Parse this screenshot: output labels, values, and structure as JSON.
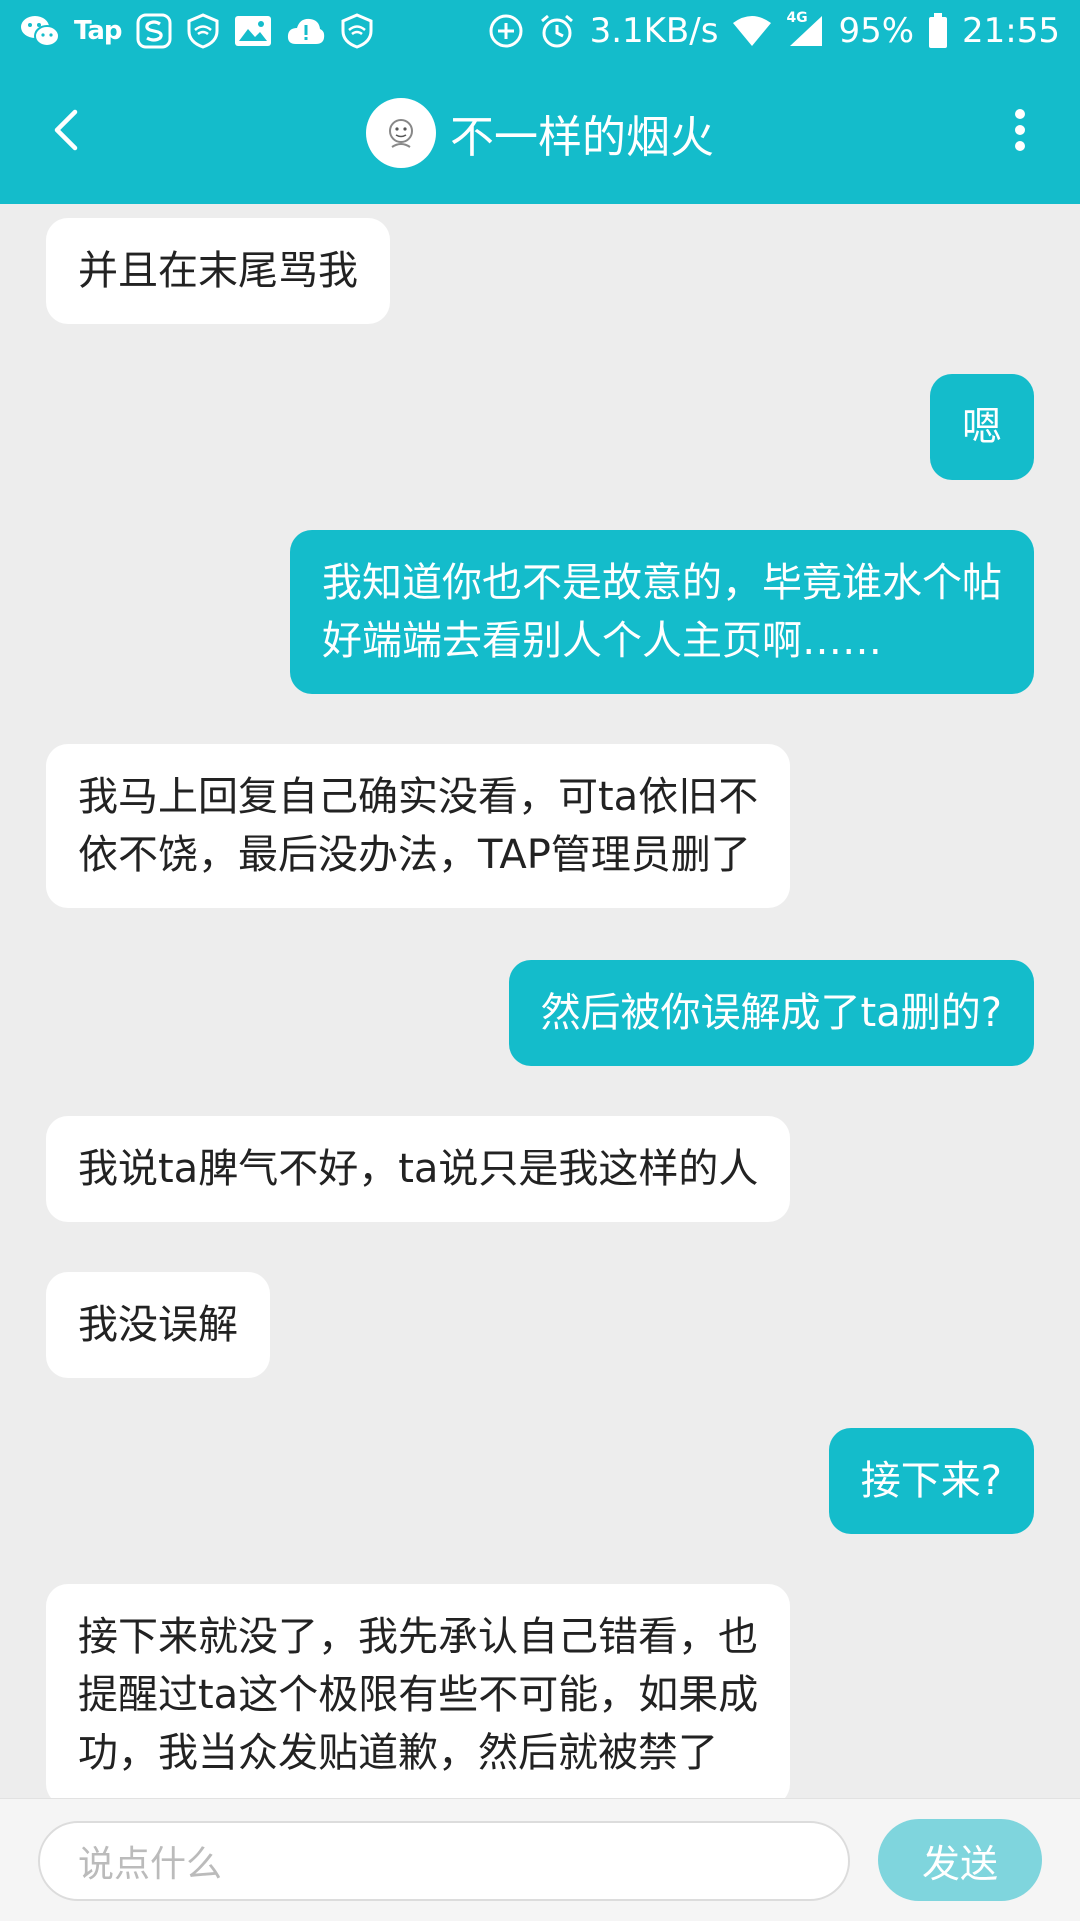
{
  "status_bar": {
    "left_icons": [
      "wechat-icon",
      "tap-icon",
      "s-app-icon",
      "shield-icon",
      "image-icon",
      "cloud-alert-icon",
      "shield-icon"
    ],
    "tap_label": "Tap",
    "network_speed": "3.1KB/s",
    "network_type": "4G",
    "battery": "95%",
    "time": "21:55"
  },
  "header": {
    "title": "不一样的烟火",
    "back_icon": "chevron-left-icon",
    "more_icon": "more-vertical-icon",
    "accent_color": "#14bccb"
  },
  "messages": [
    {
      "direction": "in",
      "text": "并且在末尾骂我"
    },
    {
      "direction": "out",
      "text": "嗯"
    },
    {
      "direction": "out",
      "text": "我知道你也不是故意的，毕竟谁水个帖\n好端端去看别人个人主页啊……"
    },
    {
      "direction": "in",
      "text": "我马上回复自己确实没看，可ta依旧不\n依不饶，最后没办法，TAP管理员删了"
    },
    {
      "direction": "out",
      "text": "然后被你误解成了ta删的?"
    },
    {
      "direction": "in",
      "text": "我说ta脾气不好，ta说只是我这样的人"
    },
    {
      "direction": "in",
      "text": "我没误解"
    },
    {
      "direction": "out",
      "text": "接下来?"
    },
    {
      "direction": "in",
      "text": "接下来就没了，我先承认自己错看，也\n提醒过ta这个极限有些不可能，如果成\n功，我当众发贴道歉，然后就被禁了"
    }
  ],
  "input_bar": {
    "placeholder": "说点什么",
    "send_label": "发送"
  }
}
